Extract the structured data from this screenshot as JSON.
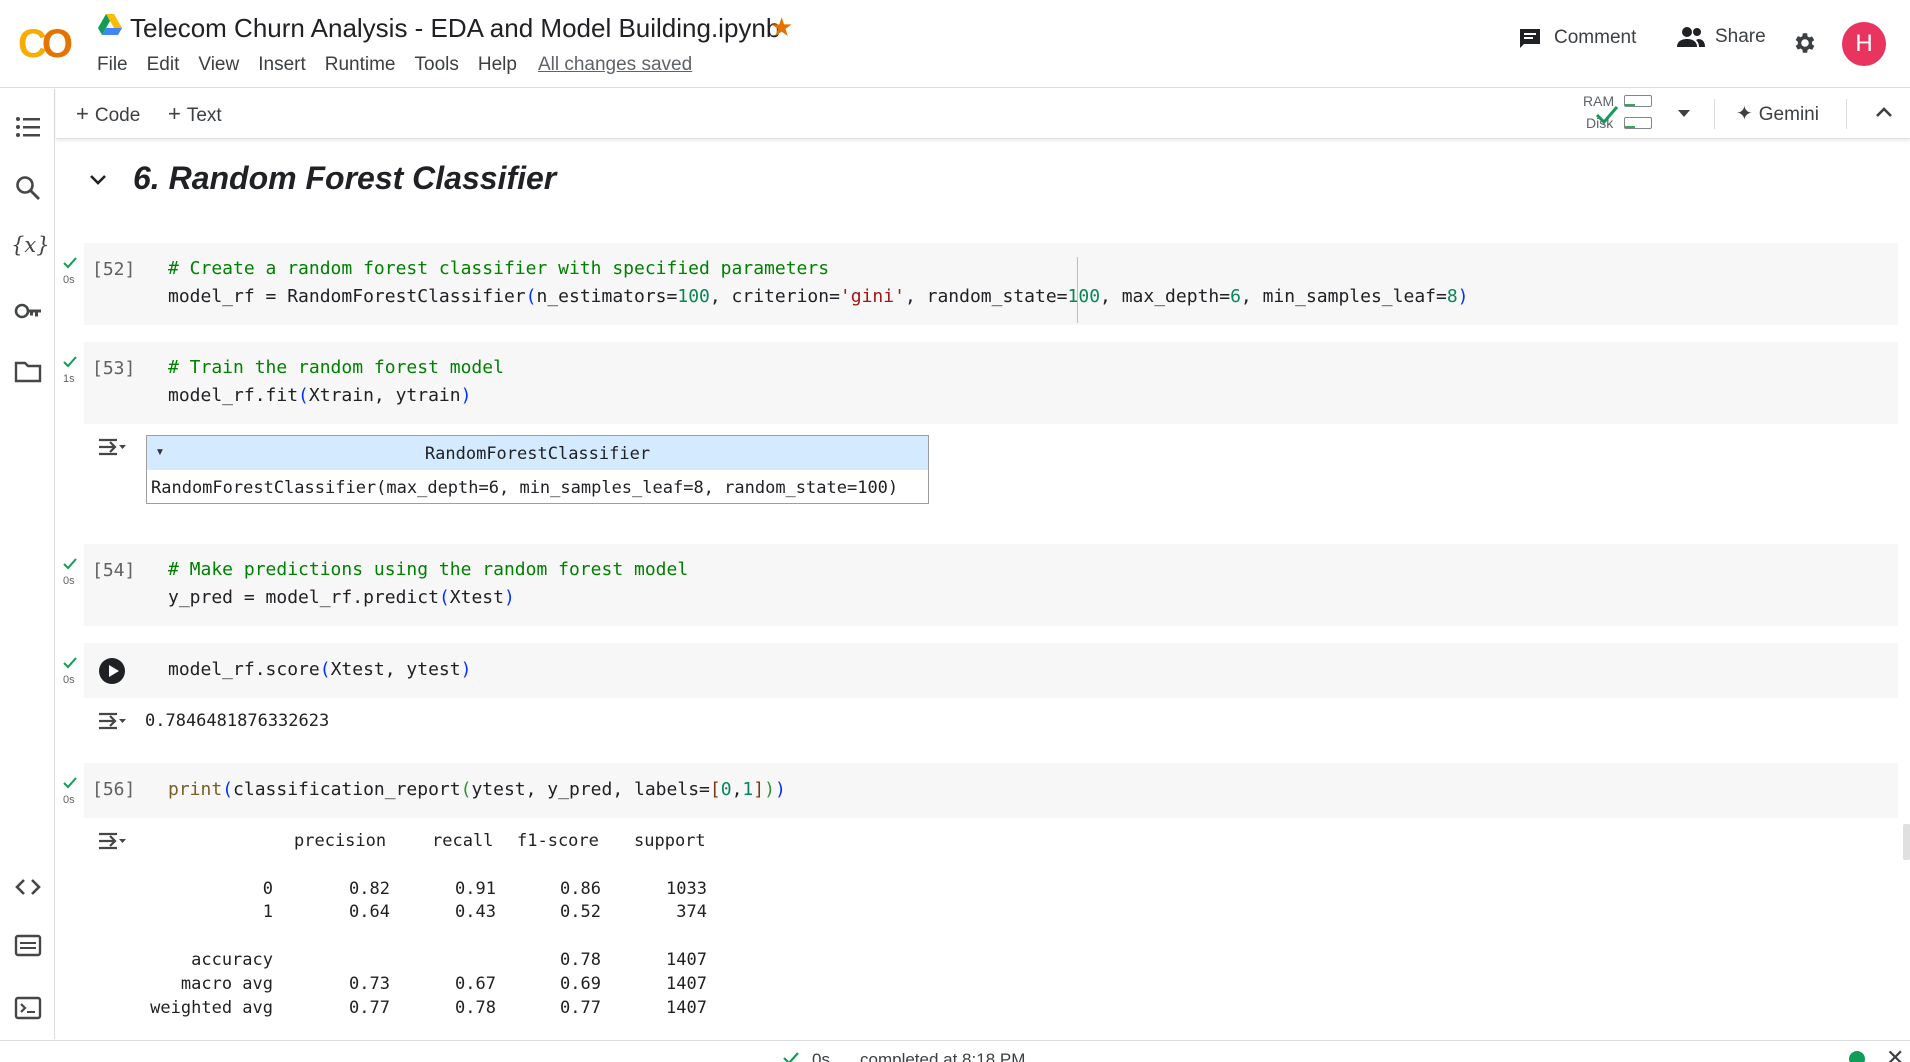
{
  "header": {
    "logo_left": "C",
    "logo_right": "O",
    "title": "Telecom Churn Analysis - EDA and Model Building.ipynb",
    "menu": [
      "File",
      "Edit",
      "View",
      "Insert",
      "Runtime",
      "Tools",
      "Help"
    ],
    "save_status": "All changes saved",
    "comment_label": "Comment",
    "share_label": "Share",
    "avatar_initial": "H"
  },
  "toolbar": {
    "add_code": "Code",
    "add_text": "Text",
    "ram_label": "RAM",
    "disk_label": "Disk",
    "gemini_label": "Gemini"
  },
  "section": {
    "title": "6. Random Forest Classifier"
  },
  "cells": [
    {
      "count": "[52]",
      "time": "0s",
      "comment": "# Create a random forest classifier with specified parameters"
    },
    {
      "count": "[53]",
      "time": "1s",
      "comment": "# Train the random forest model"
    },
    {
      "count": "[54]",
      "time": "0s",
      "comment": "# Make predictions using the random forest model"
    },
    {
      "count": "",
      "time": "0s"
    },
    {
      "count": "[56]",
      "time": "0s"
    }
  ],
  "outputs": {
    "estimator_name": "RandomForestClassifier",
    "estimator_params": "RandomForestClassifier(max_depth=6, min_samples_leaf=8, random_state=100)",
    "score": "0.7846481876332623",
    "report": {
      "headers": [
        "precision",
        "recall",
        "f1-score",
        "support"
      ],
      "rows": [
        {
          "label": "0",
          "precision": "0.82",
          "recall": "0.91",
          "f1": "0.86",
          "support": "1033"
        },
        {
          "label": "1",
          "precision": "0.64",
          "recall": "0.43",
          "f1": "0.52",
          "support": "374"
        },
        {
          "label": "accuracy",
          "precision": "",
          "recall": "",
          "f1": "0.78",
          "support": "1407"
        },
        {
          "label": "macro avg",
          "precision": "0.73",
          "recall": "0.67",
          "f1": "0.69",
          "support": "1407"
        },
        {
          "label": "weighted avg",
          "precision": "0.77",
          "recall": "0.78",
          "f1": "0.77",
          "support": "1407"
        }
      ]
    }
  },
  "status": {
    "time": "0s",
    "message": "completed at 8:18 PM"
  },
  "colors": {
    "accent_orange": "#e37400",
    "avatar": "#e8345f",
    "success_green": "#0f9d58"
  },
  "icons": [
    "drive-icon",
    "star-icon",
    "comment-icon",
    "share-icon",
    "gear-icon",
    "toc-icon",
    "search-icon",
    "variables-icon",
    "key-icon",
    "folder-icon",
    "code-snippets-icon",
    "command-palette-icon",
    "terminal-icon",
    "checkmark-icon",
    "chevron-down-icon",
    "gemini-sparkle-icon",
    "chevron-up-icon",
    "output-toggle-icon",
    "run-icon",
    "close-icon"
  ]
}
